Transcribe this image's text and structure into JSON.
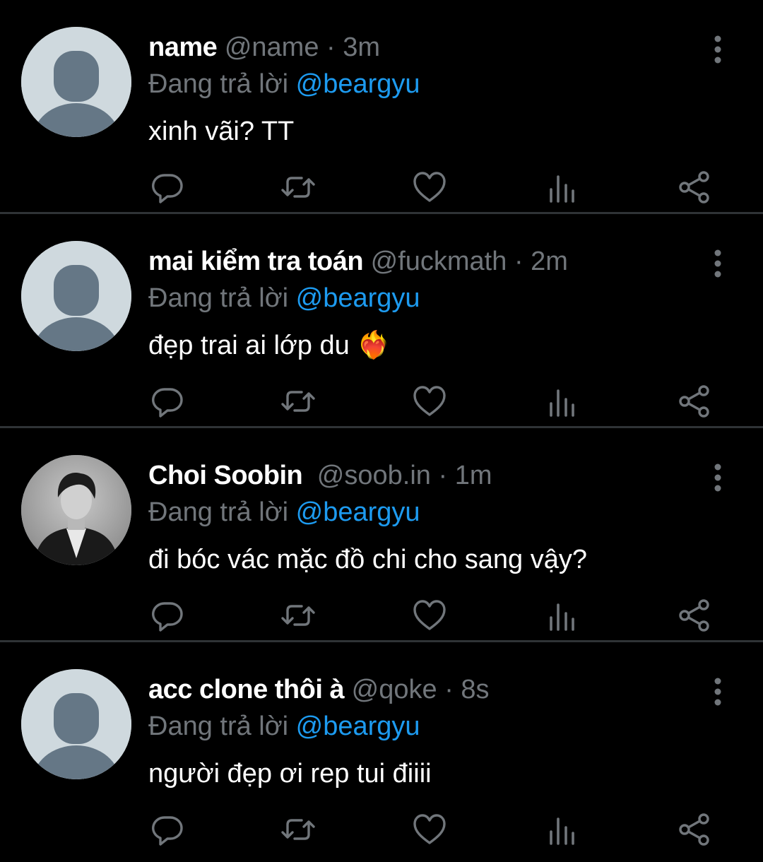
{
  "colors": {
    "background": "#000000",
    "name": "#ffffff",
    "muted": "#71767b",
    "link": "#1d9bf0",
    "divider": "#2f3336",
    "default_avatar": "#cfd9de"
  },
  "tweets": [
    {
      "name": "name",
      "handle": "@name",
      "sep": "·",
      "time": "3m",
      "reply_prefix": "Đang trả lời",
      "reply_to": "@beargyu",
      "text": "xinh vãi? TT",
      "avatar": "default-avatar-icon"
    },
    {
      "name": "mai kiểm tra toán",
      "handle": "@fuckmath",
      "sep": "·",
      "time": "2m",
      "reply_prefix": "Đang trả lời",
      "reply_to": "@beargyu",
      "text": " đẹp trai ai lớp du ❤️‍🔥",
      "avatar": "default-avatar-icon"
    },
    {
      "name": "Choi Soobin",
      "handle": "@soob.in",
      "sep": "·",
      "time": "1m",
      "reply_prefix": "Đang trả lời",
      "reply_to": "@beargyu",
      "text": "đi bóc vác mặc đồ chi cho sang vậy?",
      "avatar": "profile-photo"
    },
    {
      "name": "acc clone thôi à",
      "handle": "@qoke",
      "sep": "·",
      "time": "8s",
      "reply_prefix": "Đang trả lời",
      "reply_to": "@beargyu",
      "text": "người đẹp ơi rep tui điiii",
      "avatar": "default-avatar-icon"
    }
  ],
  "action_icons": [
    "reply-icon",
    "retweet-icon",
    "like-icon",
    "views-icon",
    "share-icon"
  ]
}
